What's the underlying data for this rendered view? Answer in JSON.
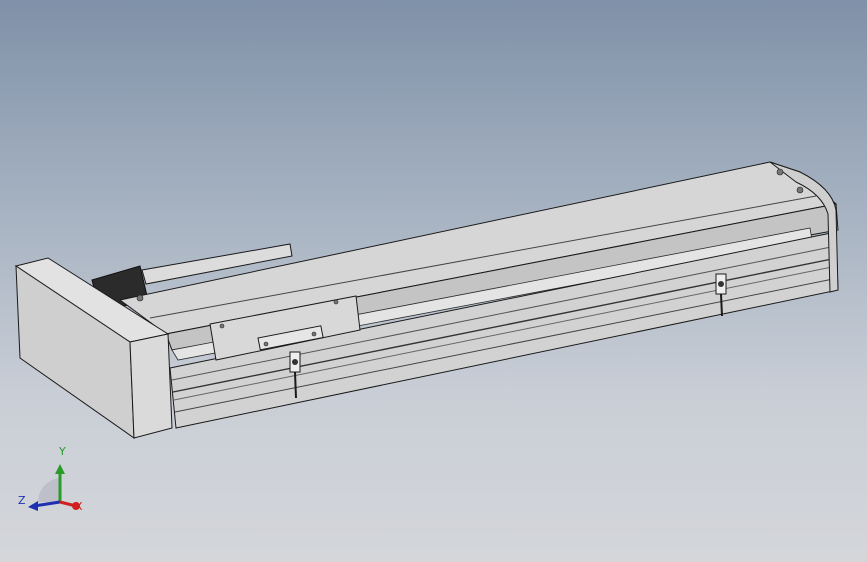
{
  "viewport": {
    "background_top": "#7f91a8",
    "background_bottom": "#d4d6da"
  },
  "model": {
    "body_color": "#d9d9d9",
    "edge_color": "#1a1a1a",
    "motor_color": "#2b2b2b"
  },
  "triad": {
    "y_label": "Y",
    "z_label": "Z",
    "x_label": "X",
    "y_color": "#2a9a2a",
    "z_color": "#1e2fb0",
    "x_color": "#d02020"
  }
}
